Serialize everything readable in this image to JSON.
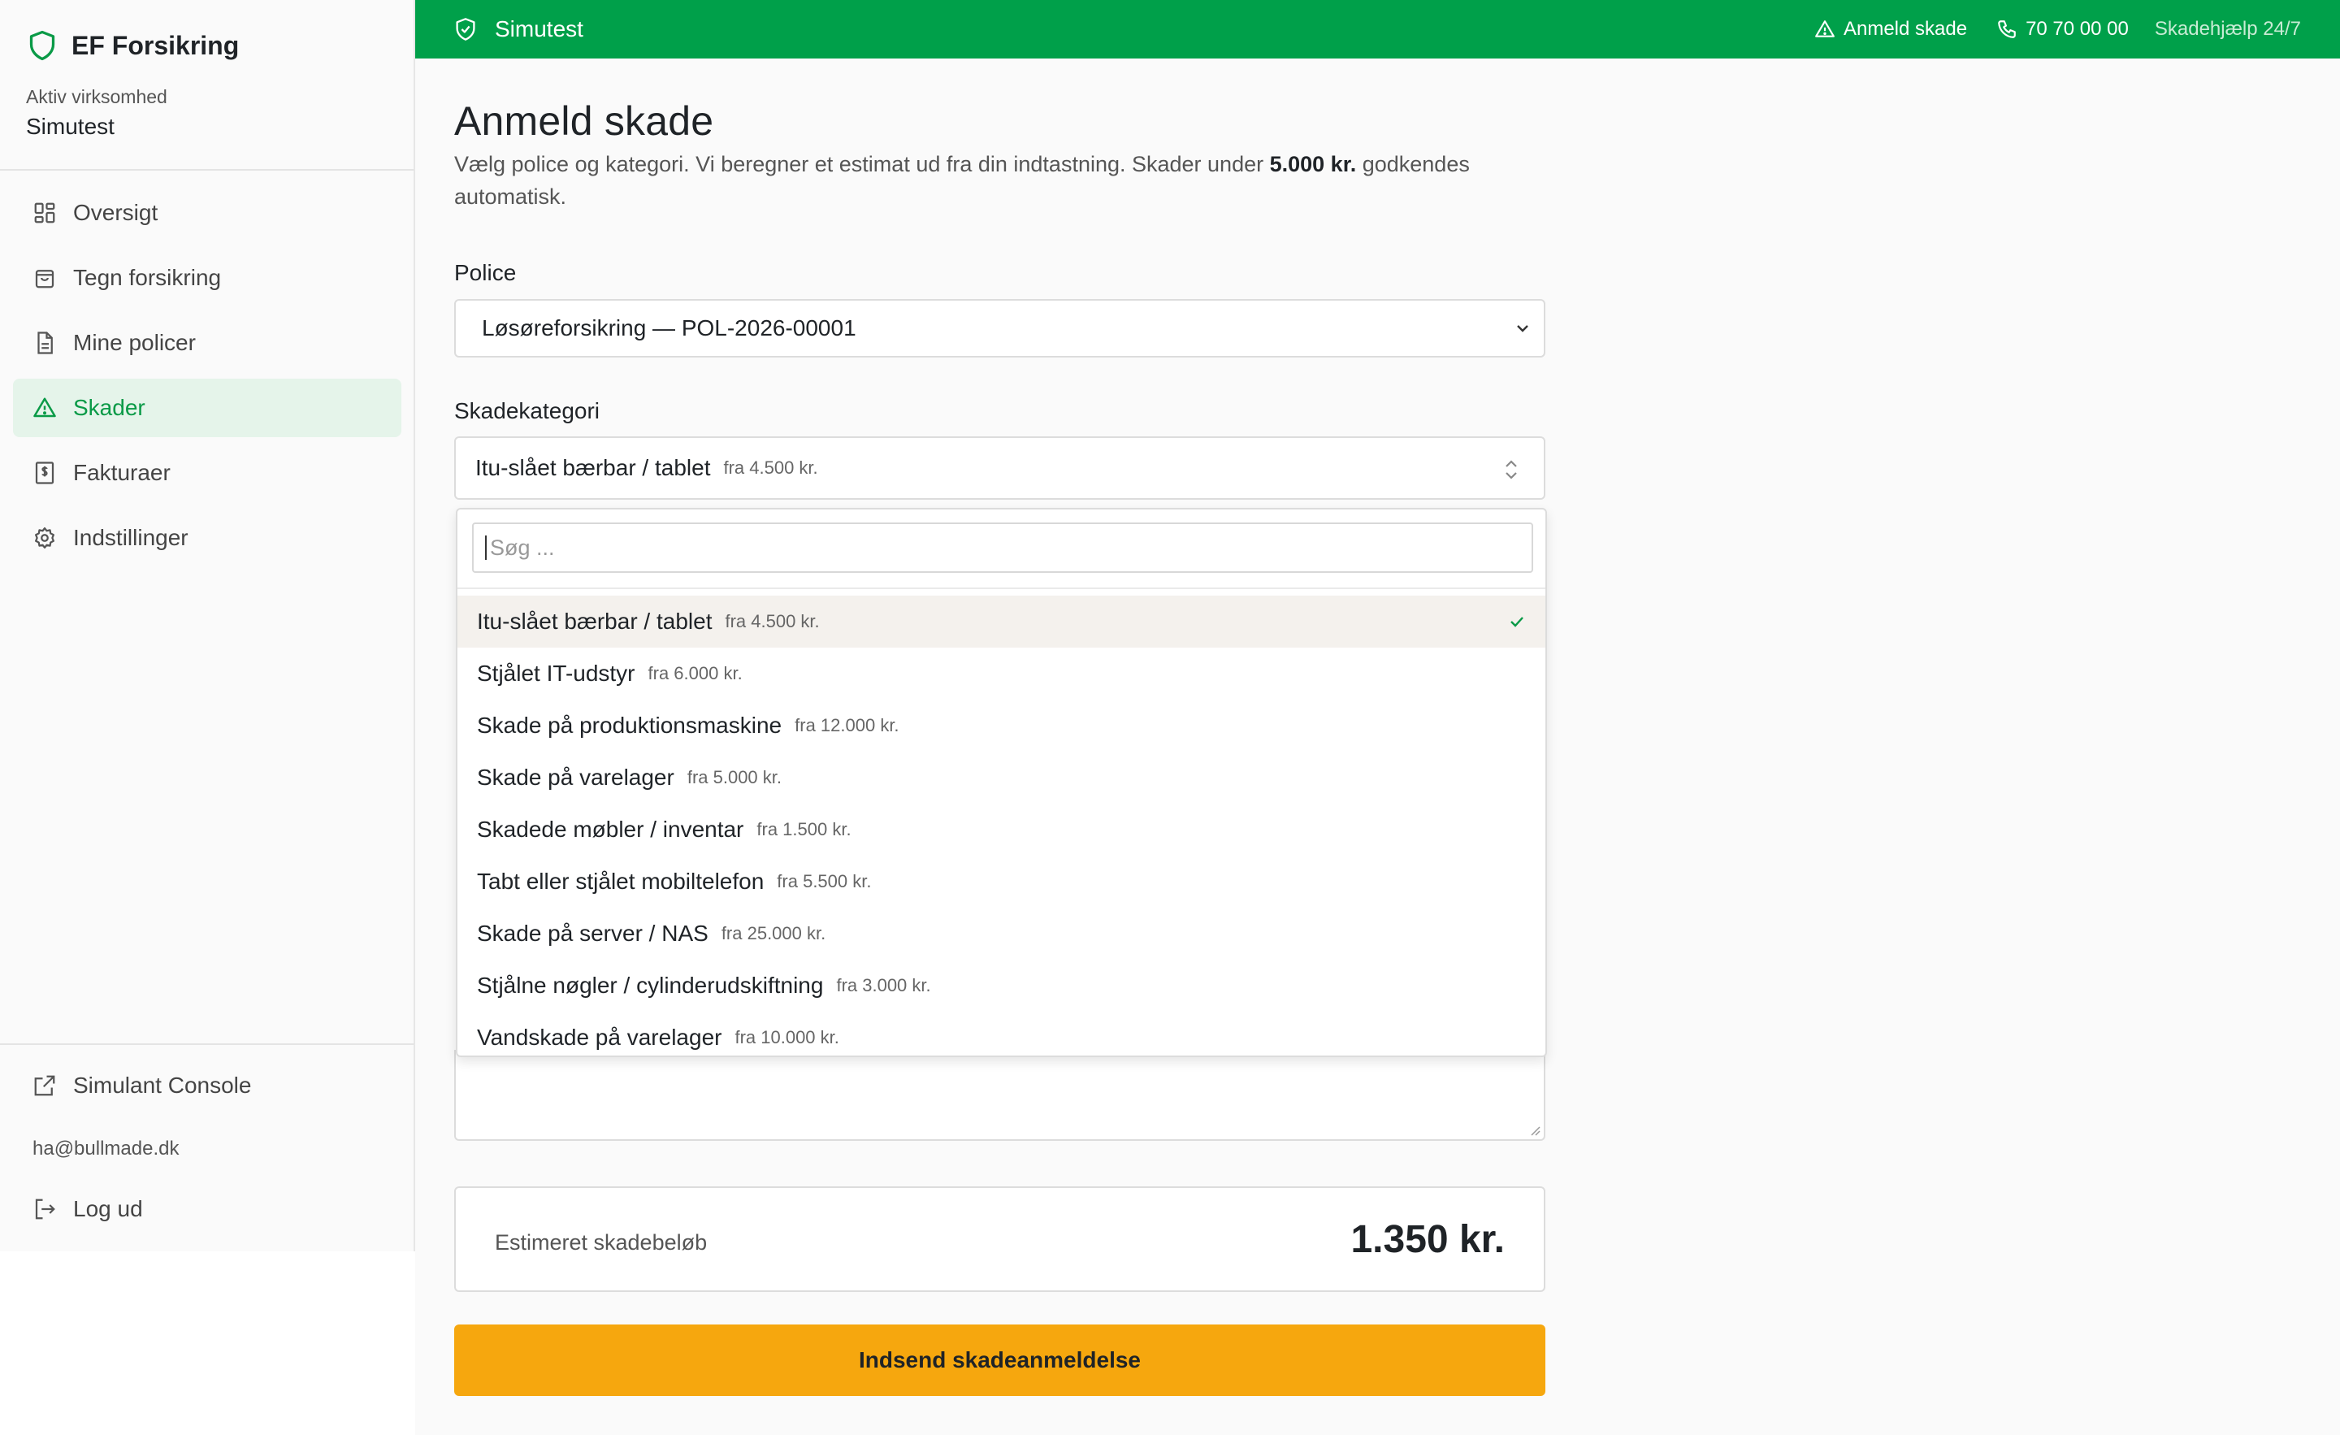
{
  "brand": {
    "name": "EF Forsikring"
  },
  "org": {
    "label": "Aktiv virksomhed",
    "name": "Simutest"
  },
  "nav": {
    "items": [
      {
        "label": "Oversigt"
      },
      {
        "label": "Tegn forsikring"
      },
      {
        "label": "Mine policer"
      },
      {
        "label": "Skader"
      },
      {
        "label": "Fakturaer"
      },
      {
        "label": "Indstillinger"
      }
    ],
    "active": "Skader",
    "bottom": {
      "console": "Simulant Console",
      "email": "ha@bullmade.dk",
      "logout": "Log ud"
    }
  },
  "topbar": {
    "title": "Simutest",
    "report": "Anmeld skade",
    "phone": "70 70 00 00",
    "help": "Skadehjælp 24/7"
  },
  "page": {
    "title": "Anmeld skade",
    "lead_before": "Vælg police og kategori. Vi beregner et estimat ud fra din indtastning. Skader under ",
    "lead_bold": "5.000 kr.",
    "lead_after": " godkendes automatisk."
  },
  "form": {
    "police_label": "Police",
    "police_value": "Løsøreforsikring — POL-2026-00001",
    "category_label": "Skadekategori",
    "category_value": "Itu-slået bærbar / tablet",
    "category_price": "fra 4.500 kr.",
    "search_placeholder": "Søg ...",
    "options": [
      {
        "label": "Itu-slået bærbar / tablet",
        "price": "fra 4.500 kr.",
        "selected": true
      },
      {
        "label": "Stjålet IT-udstyr",
        "price": "fra 6.000 kr."
      },
      {
        "label": "Skade på produktionsmaskine",
        "price": "fra 12.000 kr."
      },
      {
        "label": "Skade på varelager",
        "price": "fra 5.000 kr."
      },
      {
        "label": "Skadede møbler / inventar",
        "price": "fra 1.500 kr."
      },
      {
        "label": "Tabt eller stjålet mobiltelefon",
        "price": "fra 5.500 kr."
      },
      {
        "label": "Skade på server / NAS",
        "price": "fra 25.000 kr."
      },
      {
        "label": "Stjålne nøgler / cylinderudskiftning",
        "price": "fra 3.000 kr."
      },
      {
        "label": "Vandskade på varelager",
        "price": "fra 10.000 kr."
      }
    ],
    "estimate_label": "Estimeret skadebeløb",
    "estimate_value": "1.350 kr.",
    "submit_label": "Indsend skadeanmeldelse"
  },
  "colors": {
    "brand_green": "#00a04a",
    "active_green": "#0a9a47",
    "active_bg": "#e5f4ea",
    "submit_bg": "#f6a70e"
  }
}
